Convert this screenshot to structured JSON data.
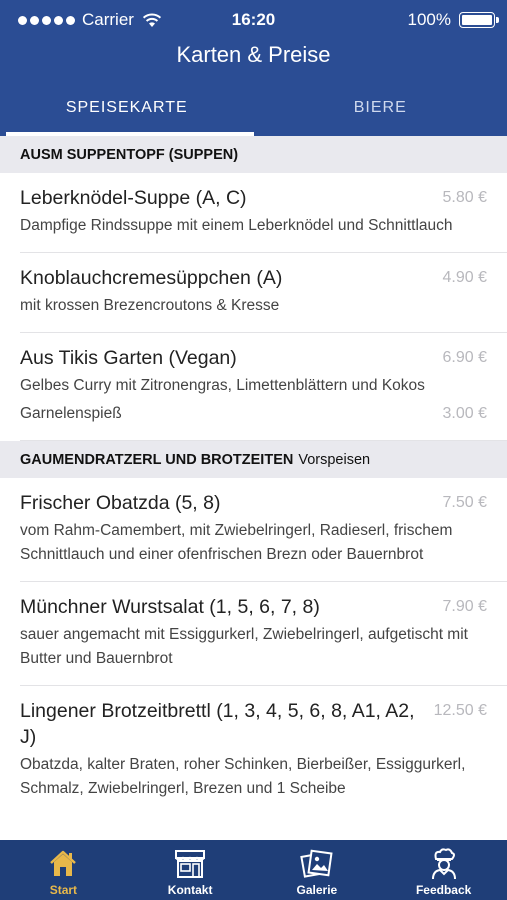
{
  "status": {
    "carrier": "Carrier",
    "time": "16:20",
    "battery": "100%"
  },
  "nav": {
    "title": "Karten & Preise"
  },
  "tabs": [
    {
      "label": "SPEISEKARTE",
      "active": true
    },
    {
      "label": "BIERE",
      "active": false
    }
  ],
  "sections": [
    {
      "title": "AUSM SUPPENTOPF (SUPPEN)",
      "subtitle": "",
      "items": [
        {
          "name": "Leberknödel-Suppe (A, C)",
          "price": "5.80 €",
          "desc": "Dampfige Rindssuppe mit einem Leberknödel und Schnittlauch"
        },
        {
          "name": "Knoblauchcremesüppchen (A)",
          "price": "4.90 €",
          "desc": "mit krossen Brezencroutons & Kresse"
        },
        {
          "name": "Aus Tikis Garten (Vegan)",
          "price": "6.90 €",
          "desc": "Gelbes Curry mit Zitronengras, Limettenblättern und Kokos",
          "extra": {
            "label": "Garnelenspieß",
            "price": "3.00 €"
          }
        }
      ]
    },
    {
      "title": "GAUMENDRATZERL UND BROTZEITEN",
      "subtitle": "Vorspeisen",
      "items": [
        {
          "name": "Frischer Obatzda (5, 8)",
          "price": "7.50 €",
          "desc": "vom Rahm-Camembert, mit Zwiebelringerl, Radieserl, frischem Schnittlauch und einer ofenfrischen Brezn oder Bauernbrot"
        },
        {
          "name": "Münchner Wurstsalat (1, 5, 6, 7, 8)",
          "price": "7.90 €",
          "desc": "sauer angemacht mit Essiggurkerl, Zwiebelringerl, aufgetischt mit Butter und Bauernbrot"
        },
        {
          "name": "Lingener Brotzeitbrettl (1, 3, 4, 5, 6, 8, A1, A2, J)",
          "price": "12.50 €",
          "desc": "Obatzda, kalter Braten, roher Schinken, Bierbeißer, Essiggurkerl, Schmalz, Zwiebelringerl, Brezen und 1 Scheibe"
        }
      ]
    }
  ],
  "tabbar": [
    {
      "label": "Start",
      "icon": "home-icon",
      "active": true
    },
    {
      "label": "Kontakt",
      "icon": "storefront-icon",
      "active": false
    },
    {
      "label": "Galerie",
      "icon": "gallery-icon",
      "active": false
    },
    {
      "label": "Feedback",
      "icon": "chef-icon",
      "active": false
    }
  ],
  "colors": {
    "header": "#2b4d94",
    "tabbar": "#1f3e78",
    "active_tab_label": "#e8b84a",
    "section_bg": "#e9e9ee",
    "price": "#b8b8bd"
  }
}
